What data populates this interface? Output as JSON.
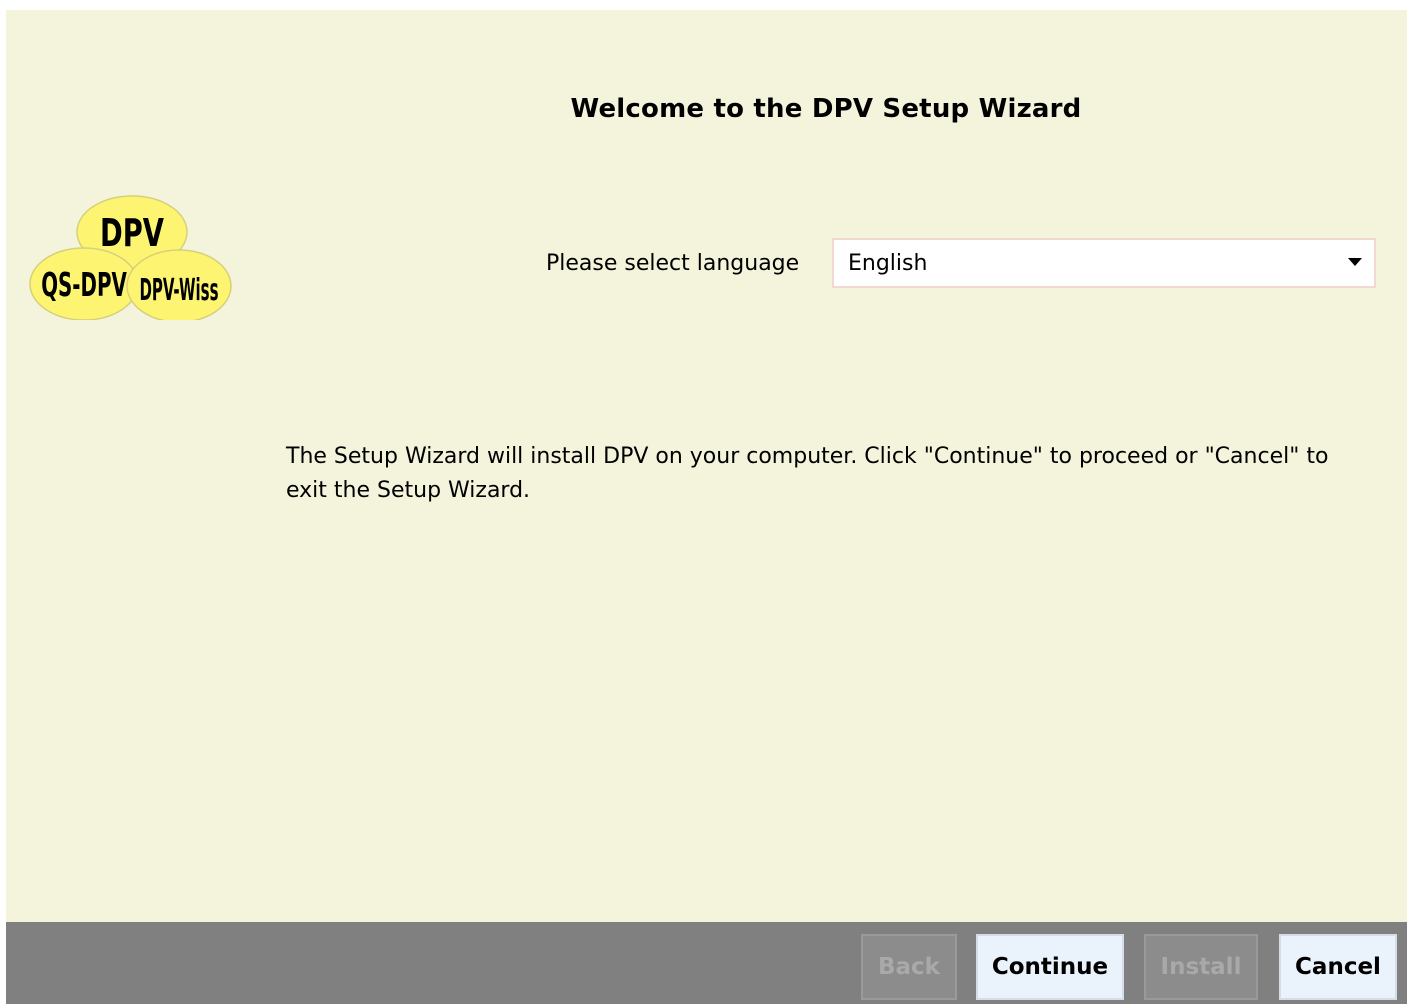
{
  "wizard": {
    "title": "Welcome to the DPV Setup Wizard",
    "logo": {
      "top_label": "DPV",
      "left_label": "QS-DPV",
      "right_label": "DPV-Wiss",
      "fill_color": "#fdf571"
    },
    "language": {
      "label": "Please select language",
      "selected": "English"
    },
    "description": "The Setup Wizard will install DPV on your computer. Click \"Continue\" to proceed or \"Cancel\" to exit the Setup Wizard."
  },
  "footer": {
    "back_label": "Back",
    "continue_label": "Continue",
    "install_label": "Install",
    "cancel_label": "Cancel"
  },
  "colors": {
    "background": "#f4f3dc",
    "footer": "#808080",
    "button": "#eaf2fb",
    "disabled_button": "#8c8c8c"
  }
}
